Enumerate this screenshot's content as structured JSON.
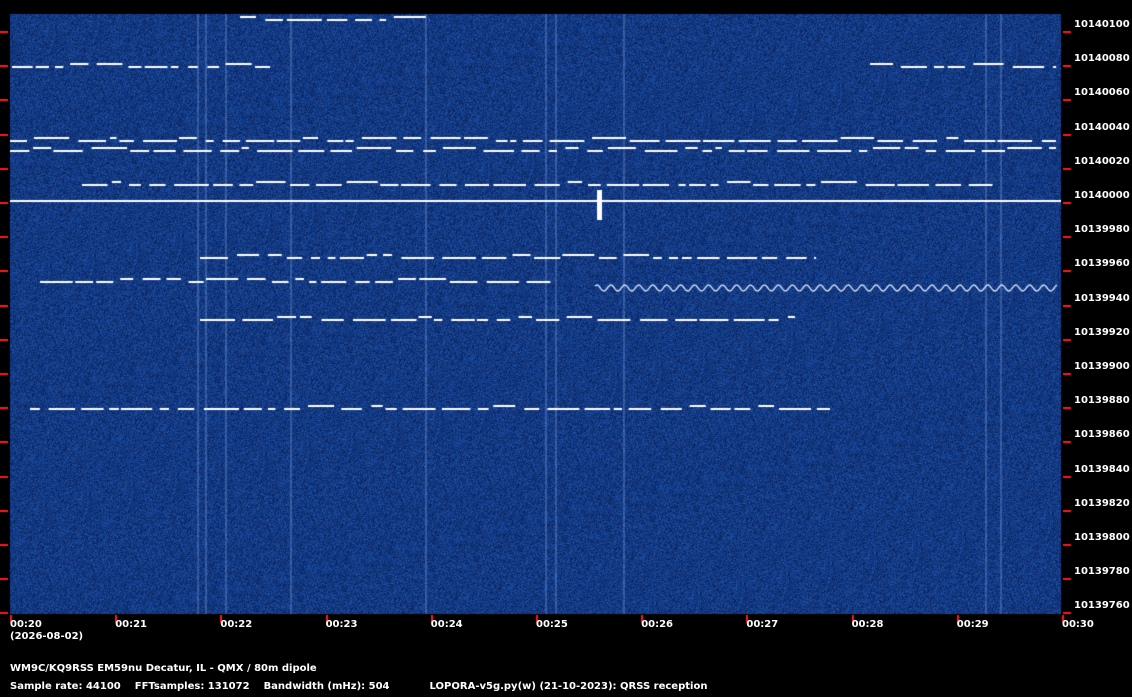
{
  "spectrogram": {
    "background_color": "#0b2a66",
    "signal_color": "#ffffff",
    "tick_color": "#ff1a1a"
  },
  "y_axis": {
    "labels": [
      "10140100",
      "10140080",
      "10140060",
      "10140040",
      "10140020",
      "10140000",
      "10139980",
      "10139960",
      "10139940",
      "10139920",
      "10139900",
      "10139880",
      "10139860",
      "10139840",
      "10139820",
      "10139800",
      "10139780",
      "10139760"
    ]
  },
  "x_axis": {
    "labels": [
      "00:20",
      "00:21",
      "00:22",
      "00:23",
      "00:24",
      "00:25",
      "00:26",
      "00:27",
      "00:28",
      "00:29",
      "00:30"
    ],
    "date": "(2026-08-02)"
  },
  "footer": {
    "station": "WM9C/KQ9RSS EM59nu Decatur, IL - QMX / 80m dipole",
    "sample_rate": "Sample rate: 44100",
    "fft_samples": "FFTsamples: 131072",
    "bandwidth": "Bandwidth (mHz): 504",
    "software": "LOPORA-v5g.py(w) (21-10-2023): QRSS reception"
  }
}
